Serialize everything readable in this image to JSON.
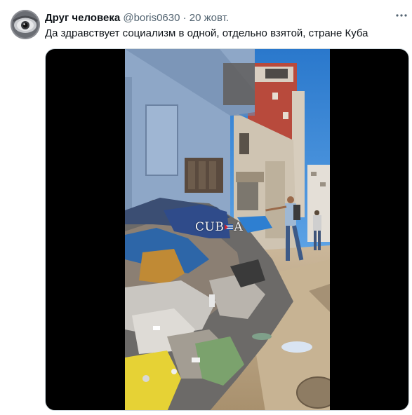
{
  "author": {
    "display_name": "Друг человека",
    "handle": "@boris0630",
    "separator": "·",
    "timestamp": "20 жовт."
  },
  "tweet": {
    "text": "Да здравствует социализм в одной, отдельно взятой, стране Куба"
  },
  "media": {
    "watermark_left": "CUB",
    "watermark_right": "A"
  },
  "icons": {
    "more": "more-horizontal-icon",
    "flag": "cuba-flag-icon"
  },
  "colors": {
    "name": "#0f1419",
    "meta": "#536471",
    "media_background": "#000000",
    "sky": "#2f7fd0"
  }
}
